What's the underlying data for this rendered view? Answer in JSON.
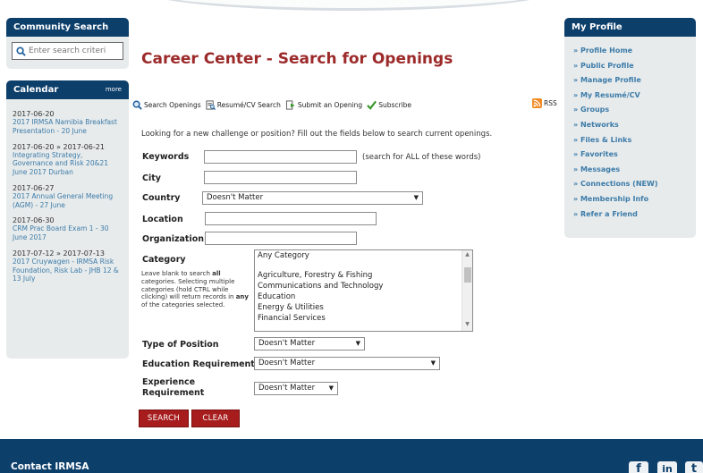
{
  "community_search": {
    "title": "Community Search",
    "placeholder": "Enter search criteri"
  },
  "calendar": {
    "title": "Calendar",
    "more": "more",
    "events": [
      {
        "date": "2017-06-20",
        "title": "2017 IRMSA Namibia Breakfast Presentation - 20 June"
      },
      {
        "date": "2017-06-20 » 2017-06-21",
        "title": "Integrating Strategy, Governance and Risk 20&21 June 2017 Durban"
      },
      {
        "date": "2017-06-27",
        "title": "2017 Annual General Meeting (AGM) - 27 June"
      },
      {
        "date": "2017-06-30",
        "title": "CRM Prac Board Exam 1 - 30 June 2017"
      },
      {
        "date": "2017-07-12 » 2017-07-13",
        "title": "2017 Cruywagen - IRMSA Risk Foundation, Risk Lab - JHB 12 & 13 July"
      }
    ]
  },
  "profile": {
    "title": "My Profile",
    "links": [
      "» Profile Home",
      "» Public Profile",
      "» Manage Profile",
      "» My Resumé/CV",
      "» Groups",
      "» Networks",
      "» Files & Links",
      "» Favorites",
      "» Messages",
      "» Connections (NEW)",
      "» Membership Info",
      "» Refer a Friend"
    ]
  },
  "main": {
    "title": "Career Center - Search for Openings",
    "toolbar": {
      "search_openings": "Search Openings",
      "resume_search": "Resumé/CV Search",
      "submit_opening": "Submit an Opening",
      "subscribe": "Subscribe",
      "rss": "RSS"
    },
    "intro": "Looking for a new challenge or position? Fill out the fields below to search current openings.",
    "form": {
      "keywords_label": "Keywords",
      "keywords_note": "(search for ALL of these words)",
      "city_label": "City",
      "country_label": "Country",
      "country_value": "Doesn't Matter",
      "location_label": "Location",
      "organization_label": "Organization",
      "category_label": "Category",
      "category_help_1": "Leave blank to search ",
      "category_help_all": "all",
      "category_help_2": " categories. Selecting multiple categories (hold CTRL while clicking) will return records in ",
      "category_help_any": "any",
      "category_help_3": " of the categories selected.",
      "category_options": [
        "Any Category",
        "Agriculture, Forestry & Fishing",
        "Communications and Technology",
        "Education",
        "Energy & Utilities",
        "Financial Services"
      ],
      "type_label": "Type of Position",
      "type_value": "Doesn't Matter",
      "education_label": "Education Requirement",
      "education_value": "Doesn't Matter",
      "experience_label_1": "Experience",
      "experience_label_2": "Requirement",
      "experience_value": "Doesn't Matter",
      "search_button": "SEARCH",
      "clear_button": "CLEAR"
    }
  },
  "footer": {
    "contact": "Contact IRMSA",
    "social": [
      "f",
      "in",
      "t"
    ]
  },
  "colors": {
    "brand_navy": "#0d3f6b",
    "title_red": "#9c2a2a",
    "button_red": "#a71c1c",
    "link_blue": "#3d7ba8",
    "panel_gray": "#e7ebec"
  }
}
